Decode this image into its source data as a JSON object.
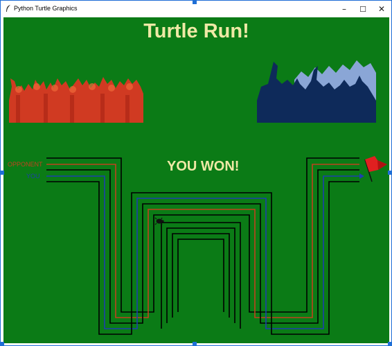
{
  "window": {
    "title": "Python Turtle Graphics",
    "minimize_icon": "minimize-icon",
    "maximize_icon": "maximize-icon",
    "close_icon": "close-icon"
  },
  "game": {
    "title": "Turtle Run!",
    "result_message": "YOU WON!",
    "lanes": {
      "opponent_label": "OPPONENT",
      "you_label": "YOU"
    },
    "colors": {
      "background": "#0b7b16",
      "title_text": "#efe9a6",
      "opponent_crowd": "#d03a22",
      "you_crowd": "#0e2a5a",
      "you_crowd_light": "#8aa6d6",
      "opponent_lane": "#c0421f",
      "you_lane": "#1d3fae",
      "flag": "#e02020"
    },
    "icons": {
      "opponent_crowd": "red-crowd-icon",
      "you_crowd": "blue-crowd-icon",
      "finish": "red-flag-icon",
      "turtle": "turtle-icon"
    }
  }
}
